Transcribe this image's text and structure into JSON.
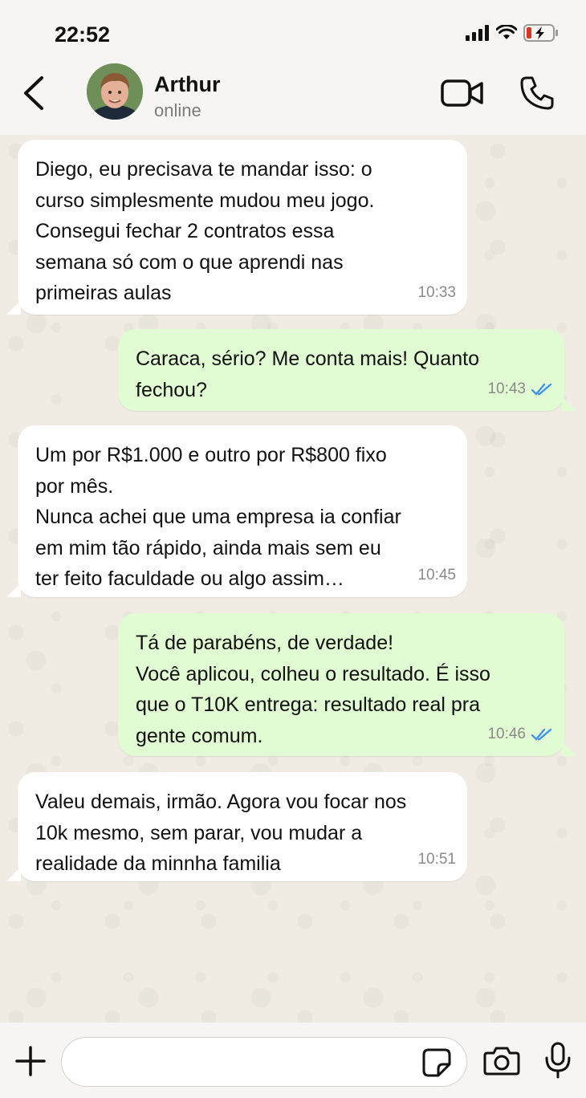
{
  "status_bar": {
    "time": "22:52"
  },
  "header": {
    "contact_name": "Arthur",
    "contact_status": "online"
  },
  "messages": [
    {
      "direction": "in",
      "text": "Diego, eu precisava te mandar isso: o\ncurso simplesmente mudou meu jogo.\nConsegui fechar 2 contratos essa\nsemana só com o que aprendi nas\nprimeiras aulas",
      "time": "10:33"
    },
    {
      "direction": "out",
      "text": "Caraca, sério? Me conta mais! Quanto\nfechou?",
      "time": "10:43",
      "status": "read"
    },
    {
      "direction": "in",
      "text": "Um por R$1.000 e outro por R$800 fixo\npor mês.\nNunca achei que uma empresa ia confiar\nem mim tão rápido, ainda mais sem eu\nter feito faculdade ou algo assim…",
      "time": "10:45"
    },
    {
      "direction": "out",
      "text": "Tá de parabéns, de verdade!\nVocê aplicou, colheu o resultado. É isso\nque o T10K entrega: resultado real pra\ngente comum.",
      "time": "10:46",
      "status": "read"
    },
    {
      "direction": "in",
      "text": "Valeu demais, irmão. Agora vou focar nos\n10k mesmo, sem parar, vou mudar a\nrealidade da minnha familia",
      "time": "10:51"
    }
  ],
  "input": {
    "value": "",
    "placeholder": ""
  },
  "colors": {
    "incoming_bubble": "#ffffff",
    "outgoing_bubble": "#e1fbd2",
    "read_ticks": "#3a8ff0",
    "chat_background": "#f0ece3"
  },
  "icons": [
    "back-icon",
    "video-call-icon",
    "phone-icon",
    "plus-icon",
    "sticker-icon",
    "camera-icon",
    "microphone-icon",
    "double-check-icon"
  ]
}
